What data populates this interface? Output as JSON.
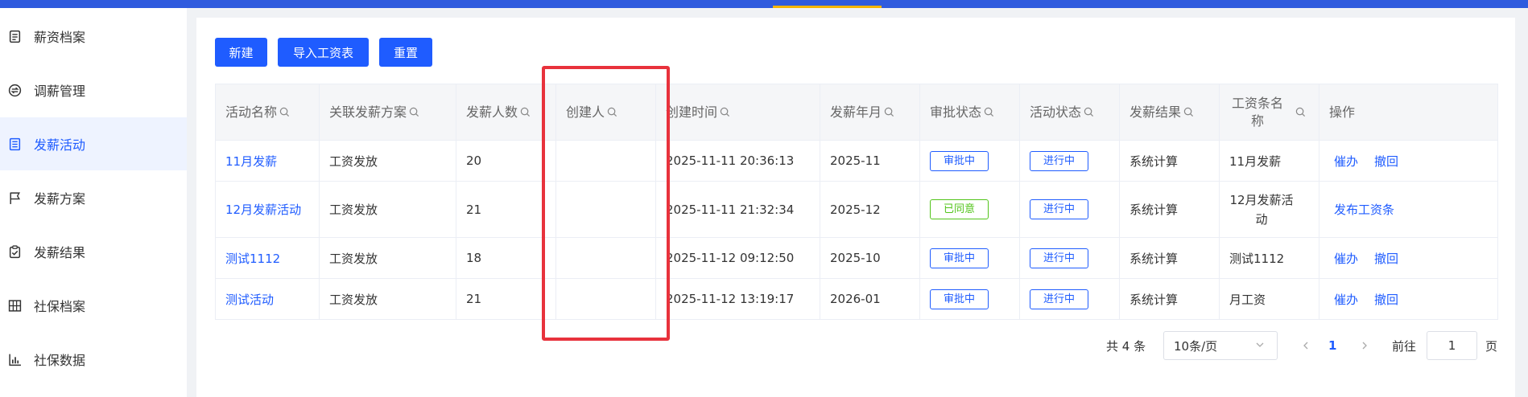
{
  "colors": {
    "primary": "#1f5cff",
    "topbar": "#2f5bde",
    "accent": "#f5b400",
    "success": "#52c41a",
    "highlight": "#e8323c"
  },
  "sidebar": {
    "items": [
      {
        "label": "薪资档案",
        "icon": "file-text-icon",
        "active": false
      },
      {
        "label": "调薪管理",
        "icon": "exchange-icon",
        "active": false
      },
      {
        "label": "发薪活动",
        "icon": "list-doc-icon",
        "active": true
      },
      {
        "label": "发薪方案",
        "icon": "flag-icon",
        "active": false
      },
      {
        "label": "发薪结果",
        "icon": "clipboard-check-icon",
        "active": false
      },
      {
        "label": "社保档案",
        "icon": "grid-icon",
        "active": false
      },
      {
        "label": "社保数据",
        "icon": "bar-chart-icon",
        "active": false
      }
    ]
  },
  "toolbar": {
    "new_label": "新建",
    "import_label": "导入工资表",
    "reset_label": "重置"
  },
  "table": {
    "headers": [
      "活动名称",
      "关联发薪方案",
      "发薪人数",
      "创建人",
      "创建时间",
      "发薪年月",
      "审批状态",
      "活动状态",
      "发薪结果",
      "工资条名称",
      "操作"
    ],
    "rows": [
      {
        "name": "11月发薪",
        "plan": "工资发放",
        "count": "20",
        "creator": "",
        "created": "2025-11-11 20:36:13",
        "month": "2025-11",
        "approval": "审批中",
        "status": "进行中",
        "result": "系统计算",
        "slip": "11月发薪",
        "op1": "催办",
        "op2": "撤回"
      },
      {
        "name": "12月发薪活动",
        "plan": "工资发放",
        "count": "21",
        "creator": "",
        "created": "2025-11-11 21:32:34",
        "month": "2025-12",
        "approval": "已同意",
        "status": "进行中",
        "result": "系统计算",
        "slip": "12月发薪活动",
        "op1": "发布工资条",
        "op2": ""
      },
      {
        "name": "测试1112",
        "plan": "工资发放",
        "count": "18",
        "creator": "",
        "created": "2025-11-12 09:12:50",
        "month": "2025-10",
        "approval": "审批中",
        "status": "进行中",
        "result": "系统计算",
        "slip": "测试1112",
        "op1": "催办",
        "op2": "撤回"
      },
      {
        "name": "测试活动",
        "plan": "工资发放",
        "count": "21",
        "creator": "",
        "created": "2025-11-12 13:19:17",
        "month": "2026-01",
        "approval": "审批中",
        "status": "进行中",
        "result": "系统计算",
        "slip": "月工资",
        "op1": "催办",
        "op2": "撤回"
      }
    ]
  },
  "pagination": {
    "total": "共 4 条",
    "page_size": "10条/页",
    "current": "1",
    "goto_label": "前往",
    "goto_value": "1",
    "page_unit": "页"
  }
}
